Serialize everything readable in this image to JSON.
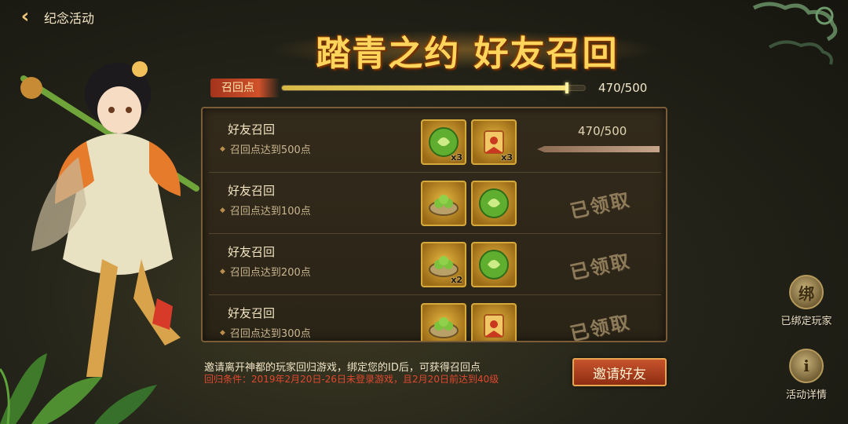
{
  "header": {
    "back_icon": "chevron-left-icon",
    "page_name": "纪念活动"
  },
  "title": "踏青之约 好友召回",
  "progress": {
    "label": "召回点",
    "current": 470,
    "max": 500,
    "text": "470/500"
  },
  "rows": [
    {
      "title": "好友召回",
      "desc": "召回点达到500点",
      "rewards": [
        {
          "icon": "jade-orb-icon",
          "count": "x3"
        },
        {
          "icon": "scroll-token-icon",
          "count": "x3"
        }
      ],
      "status": "progress",
      "progress_text": "470/500"
    },
    {
      "title": "好友召回",
      "desc": "召回点达到100点",
      "rewards": [
        {
          "icon": "dumpling-bowl-icon",
          "count": ""
        },
        {
          "icon": "jade-orb-icon",
          "count": ""
        }
      ],
      "status": "claimed",
      "stamp": "已领取"
    },
    {
      "title": "好友召回",
      "desc": "召回点达到200点",
      "rewards": [
        {
          "icon": "dumpling-bowl-icon",
          "count": "x2"
        },
        {
          "icon": "jade-orb-icon",
          "count": ""
        }
      ],
      "status": "claimed",
      "stamp": "已领取"
    },
    {
      "title": "好友召回",
      "desc": "召回点达到300点",
      "rewards": [
        {
          "icon": "dumpling-bowl-icon",
          "count": ""
        },
        {
          "icon": "scroll-token-icon",
          "count": ""
        }
      ],
      "status": "claimed",
      "stamp": "已领取"
    }
  ],
  "footer": {
    "info": "邀请离开神都的玩家回归游戏，绑定您的ID后，可获得召回点",
    "condition": "回归条件：2019年2月20日-26日未登录游戏，且2月20日前达到40级",
    "invite_button": "邀请好友"
  },
  "side": {
    "bound_label": "已绑定玩家",
    "bound_icon_glyph": "绑",
    "details_label": "活动详情",
    "details_icon_glyph": "i"
  },
  "colors": {
    "accent_gold": "#ffd55c",
    "invite_red": "#8e2c12",
    "condition_red": "#e0482e"
  }
}
